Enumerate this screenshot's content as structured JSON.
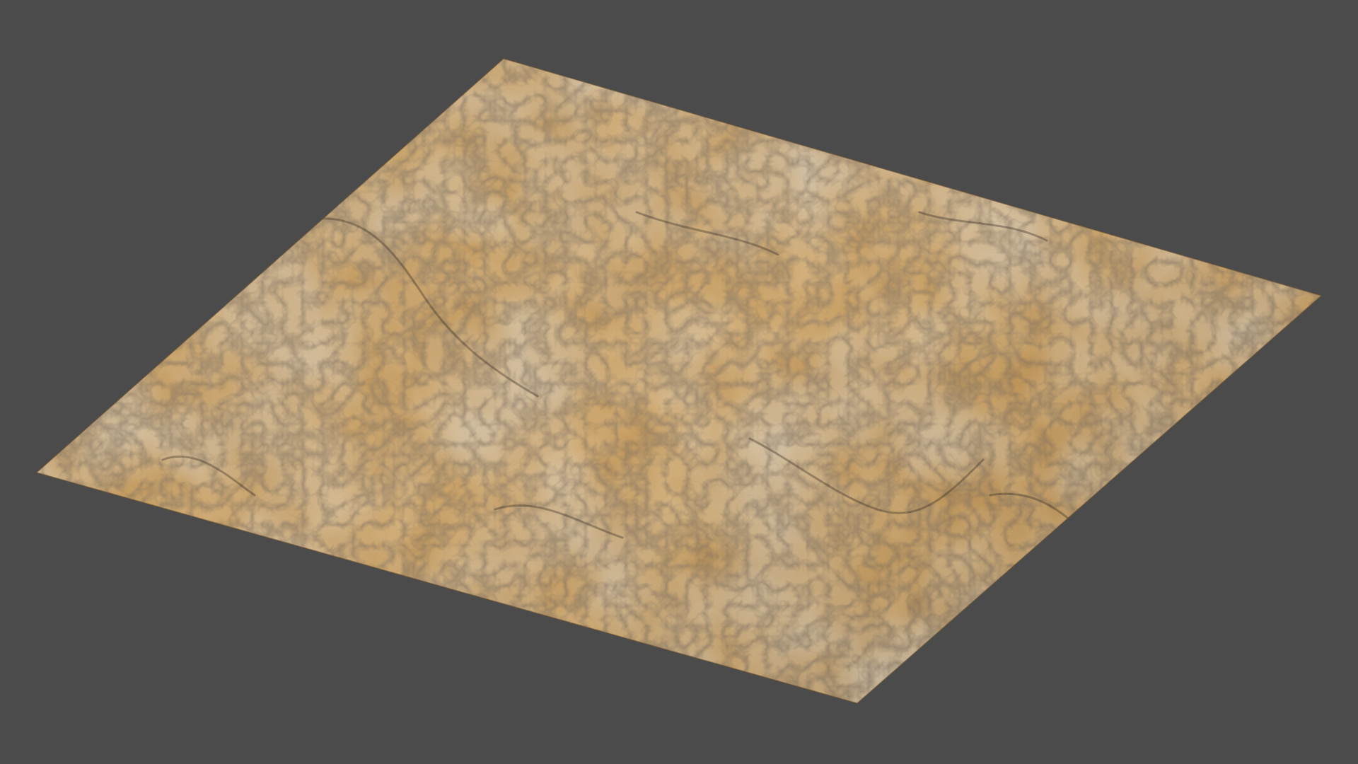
{
  "scene": {
    "subject": "textured-terrain-plane",
    "colors": {
      "background": "#4b4b4b",
      "sand_light": "#d4a45c",
      "sand_mid": "#b9874a",
      "sand_dark": "#8e6536",
      "rock_light": "#c9c3b6",
      "rock_mid": "#9b9486",
      "crack_dark": "#3a2e22"
    }
  }
}
